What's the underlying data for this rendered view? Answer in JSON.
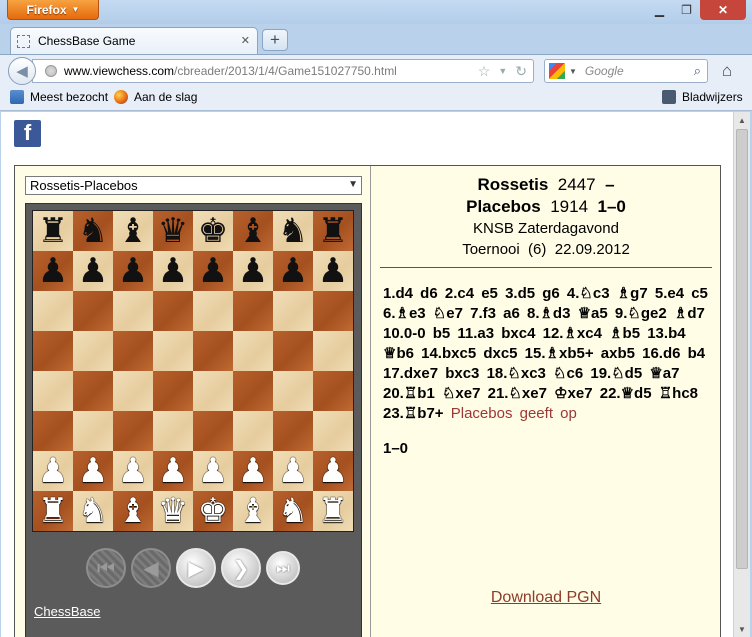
{
  "browser": {
    "menu_button": "Firefox",
    "tab_title": "ChessBase Game",
    "url_host": "www.viewchess.com",
    "url_path": "/cbreader/2013/1/4/Game151027750.html",
    "search_placeholder": "Google",
    "bookmarks": {
      "most_visited": "Meest bezocht",
      "getting_started": "Aan de slag",
      "bookmarks_menu": "Bladwijzers"
    }
  },
  "viewer": {
    "game_select": "Rossetis-Placebos",
    "brand_link": "ChessBase",
    "white_name": "Rossetis",
    "white_elo": "2447",
    "dash": "–",
    "black_name": "Placebos",
    "black_elo": "1914",
    "result": "1–0",
    "event": "KNSB Zaterdagavond",
    "round_line": "Toernooi  (6)  22.09.2012",
    "moves": "1.d4 d6 2.c4 e5 3.d5 g6 4.♘c3 ♗g7 5.e4 c5 6.♗e3 ♘e7 7.f3 a6 8.♗d3 ♕a5 9.♘ge2 ♗d7 10.0-0 b5 11.a3 bxc4 12.♗xc4 ♗b5 13.b4 ♕b6 14.bxc5 dxc5 15.♗xb5+ axb5 16.d6 b4 17.dxe7 bxc3 18.♘xc3 ♘c6 19.♘d5 ♕a7 20.♖b1 ♘xe7 21.♘xe7 ♔xe7 22.♕d5 ♖hc8 23.♖b7+",
    "resign_text": "Placebos geeft op",
    "final_result": "1–0",
    "download_link": "Download PGN",
    "board_ranks": [
      [
        "♜",
        "♞",
        "♝",
        "♛",
        "♚",
        "♝",
        "♞",
        "♜"
      ],
      [
        "♟",
        "♟",
        "♟",
        "♟",
        "♟",
        "♟",
        "♟",
        "♟"
      ],
      [
        "",
        "",
        "",
        "",
        "",
        "",
        "",
        ""
      ],
      [
        "",
        "",
        "",
        "",
        "",
        "",
        "",
        ""
      ],
      [
        "",
        "",
        "",
        "",
        "",
        "",
        "",
        ""
      ],
      [
        "",
        "",
        "",
        "",
        "",
        "",
        "",
        ""
      ],
      [
        "♟",
        "♟",
        "♟",
        "♟",
        "♟",
        "♟",
        "♟",
        "♟"
      ],
      [
        "♜",
        "♞",
        "♝",
        "♛",
        "♚",
        "♝",
        "♞",
        "♜"
      ]
    ],
    "controls": [
      {
        "name": "start-button",
        "glyph": "⏮",
        "state": "off"
      },
      {
        "name": "back-button",
        "glyph": "◀",
        "state": "off"
      },
      {
        "name": "play-button",
        "glyph": "▶",
        "state": "on"
      },
      {
        "name": "forward-button",
        "glyph": "❯",
        "state": "on"
      },
      {
        "name": "end-button",
        "glyph": "⏭",
        "state": "on"
      }
    ]
  }
}
